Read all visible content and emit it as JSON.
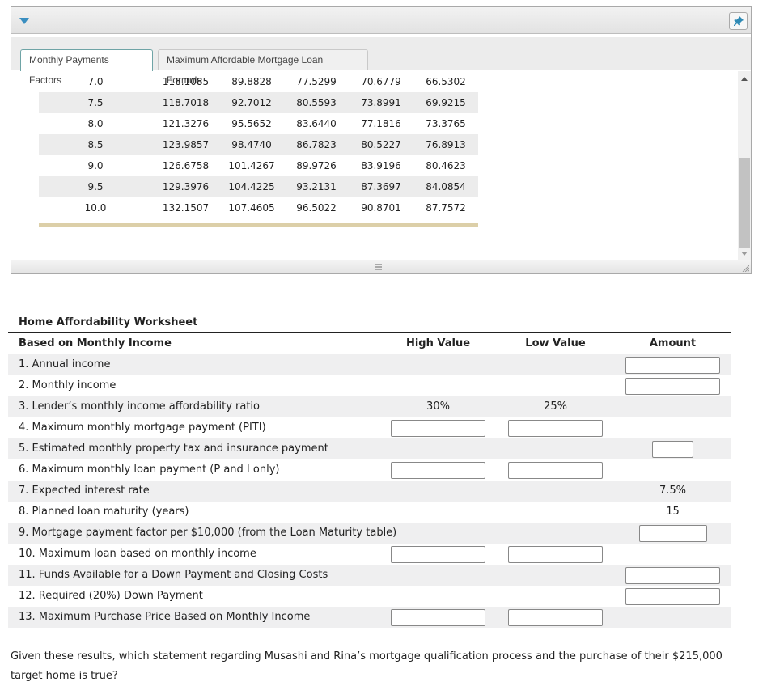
{
  "panel": {
    "collapse_icon": "triangle-down-icon",
    "pin_icon": "pushpin-icon",
    "tabs": [
      {
        "label": "Monthly Payments Factors",
        "active": true
      },
      {
        "label": "Maximum Affordable Mortgage Loan Formula",
        "active": false
      }
    ],
    "factor_rows": [
      {
        "rate": "7.0",
        "values": [
          "116.1085",
          "89.8828",
          "77.5299",
          "70.6779",
          "66.5302"
        ]
      },
      {
        "rate": "7.5",
        "values": [
          "118.7018",
          "92.7012",
          "80.5593",
          "73.8991",
          "69.9215"
        ]
      },
      {
        "rate": "8.0",
        "values": [
          "121.3276",
          "95.5652",
          "83.6440",
          "77.1816",
          "73.3765"
        ]
      },
      {
        "rate": "8.5",
        "values": [
          "123.9857",
          "98.4740",
          "86.7823",
          "80.5227",
          "76.8913"
        ]
      },
      {
        "rate": "9.0",
        "values": [
          "126.6758",
          "101.4267",
          "89.9726",
          "83.9196",
          "80.4623"
        ]
      },
      {
        "rate": "9.5",
        "values": [
          "129.3976",
          "104.4225",
          "93.2131",
          "87.3697",
          "84.0854"
        ]
      },
      {
        "rate": "10.0",
        "values": [
          "132.1507",
          "107.4605",
          "96.5022",
          "90.8701",
          "87.7572"
        ]
      }
    ],
    "scroll_position": 0.85
  },
  "worksheet": {
    "title": "Home Affordability Worksheet",
    "section_label": "Based on Monthly Income",
    "columns": {
      "high": "High Value",
      "low": "Low Value",
      "amount": "Amount"
    },
    "rows": [
      {
        "label": "1. Annual income",
        "amount_input": ""
      },
      {
        "label": "2. Monthly income",
        "amount_input": ""
      },
      {
        "label": "3. Lender’s monthly income affordability ratio",
        "high": "30%",
        "low": "25%"
      },
      {
        "label": "4. Maximum monthly mortgage payment (PITI)",
        "high_input": "",
        "low_input": ""
      },
      {
        "label": "5. Estimated monthly property tax and insurance payment",
        "amount_input": ""
      },
      {
        "label": "6. Maximum monthly loan payment (P and I only)",
        "high_input": "",
        "low_input": ""
      },
      {
        "label": "7. Expected interest rate",
        "amount": "7.5%"
      },
      {
        "label": "8. Planned loan maturity (years)",
        "amount": "15"
      },
      {
        "label": "9. Mortgage payment factor per $10,000 (from the Loan Maturity table)",
        "amount_input": ""
      },
      {
        "label": "10. Maximum loan based on monthly income",
        "high_input": "",
        "low_input": ""
      },
      {
        "label": "11. Funds Available for a Down Payment and Closing Costs",
        "amount_input": ""
      },
      {
        "label": "12. Required (20%) Down Payment",
        "amount_input": ""
      },
      {
        "label": "13. Maximum Purchase Price Based on Monthly Income",
        "high_input": "",
        "low_input": ""
      }
    ]
  },
  "question": "Given these results, which statement regarding Musashi and Rina’s mortgage qualification process and the purchase of their $215,000 target home is true?"
}
